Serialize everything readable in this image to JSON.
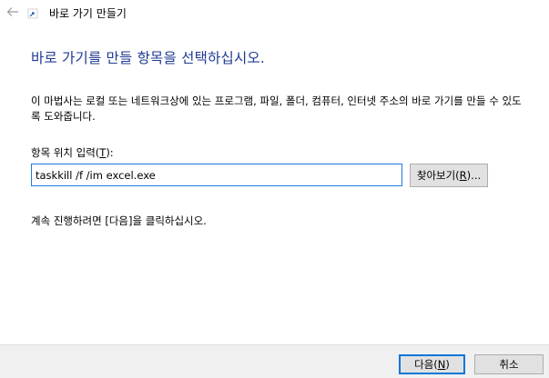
{
  "window": {
    "title": "바로 가기 만들기",
    "back_icon": "back-arrow-icon",
    "app_icon": "shortcut-icon"
  },
  "heading": "바로 가기를 만들 항목을 선택하십시오.",
  "description": "이 마법사는 로컬 또는 네트워크상에 있는 프로그램, 파일, 폴더, 컴퓨터, 인터넷 주소의 바로 가기를 만들 수 있도록 도와줍니다.",
  "field": {
    "label_prefix": "항목 위치 입력(",
    "label_accel": "T",
    "label_suffix": "):",
    "value": "taskkill /f /im excel.exe"
  },
  "browse": {
    "label_prefix": "찾아보기(",
    "label_accel": "R",
    "label_suffix": ")..."
  },
  "continue_text": "계속 진행하려면 [다음]을 클릭하십시오.",
  "footer": {
    "next_prefix": "다음(",
    "next_accel": "N",
    "next_suffix": ")",
    "cancel": "취소"
  },
  "colors": {
    "heading": "#1f3a93",
    "focus_border": "#0078d7",
    "footer_bg": "#f0f0f0",
    "button_bg": "#e1e1e1"
  }
}
